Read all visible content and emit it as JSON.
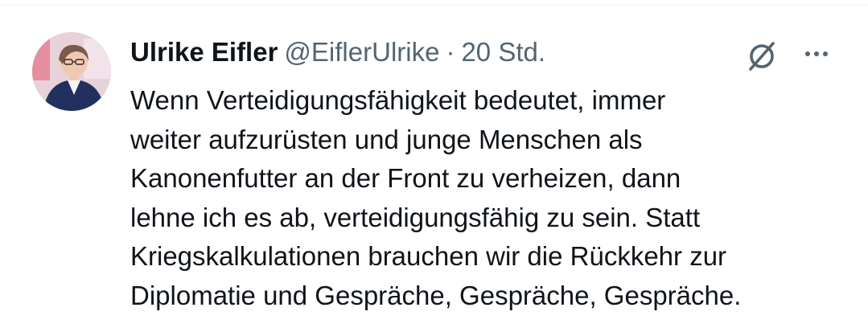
{
  "tweet": {
    "display_name": "Ulrike Eifler",
    "handle": "@EiflerUlrike",
    "separator": "·",
    "time": "20 Std.",
    "text": "Wenn Verteidigungsfähigkeit bedeutet, immer\nweiter aufzurüsten und junge Menschen als\nKanonenfutter an der Front zu verheizen, dann\nlehne ich es ab, verteidigungsfähig zu sein. Statt\nKriegskalkulationen brauchen wir die Rückkehr zur\nDiplomatie und Gespräche, Gespräche, Gespräche.",
    "icons": {
      "grok": "grok-icon",
      "more": "more-icon"
    }
  },
  "colors": {
    "text": "#0f1419",
    "secondary": "#536471",
    "divider": "#eff3f4"
  }
}
